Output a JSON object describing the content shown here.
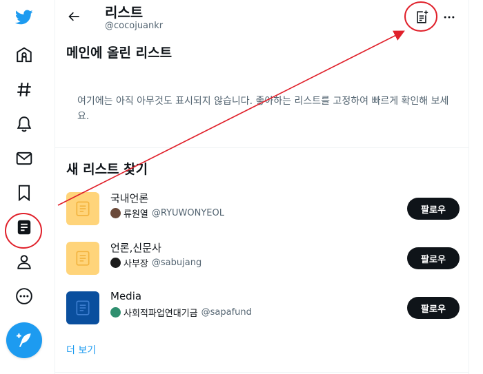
{
  "nav": {
    "items": [
      {
        "icon": "twitter-bird-icon"
      },
      {
        "icon": "home-icon"
      },
      {
        "icon": "hashtag-icon"
      },
      {
        "icon": "bell-icon"
      },
      {
        "icon": "mail-icon"
      },
      {
        "icon": "bookmark-icon"
      },
      {
        "icon": "lists-icon",
        "active": true
      },
      {
        "icon": "profile-icon"
      },
      {
        "icon": "more-circle-icon"
      },
      {
        "icon": "compose-tweet-icon"
      }
    ],
    "brand_color": "#1d9bf0"
  },
  "header": {
    "title": "리스트",
    "handle": "@cocojuankr"
  },
  "pinned": {
    "title": "메인에 올린 리스트",
    "empty_text": "여기에는 아직 아무것도 표시되지 않습니다. 좋아하는 리스트를 고정하여 빠르게 확인해 보세요."
  },
  "discover": {
    "title": "새 리스트 찾기",
    "lists": [
      {
        "name": "국내언론",
        "owner_name": "류원열",
        "owner_handle": "@RYUWONYEOL",
        "follow_label": "팔로우",
        "thumb_color": "#ffd47a"
      },
      {
        "name": "언론,신문사",
        "owner_name": "사부장",
        "owner_handle": "@sabujang",
        "follow_label": "팔로우",
        "thumb_color": "#ffd47a"
      },
      {
        "name": "Media",
        "owner_name": "사회적파업연대기금",
        "owner_handle": "@sapafund",
        "follow_label": "팔로우",
        "thumb_color": "#0a4f9e"
      }
    ],
    "see_more": "더 보기"
  },
  "annotation_color": "#e0202a"
}
